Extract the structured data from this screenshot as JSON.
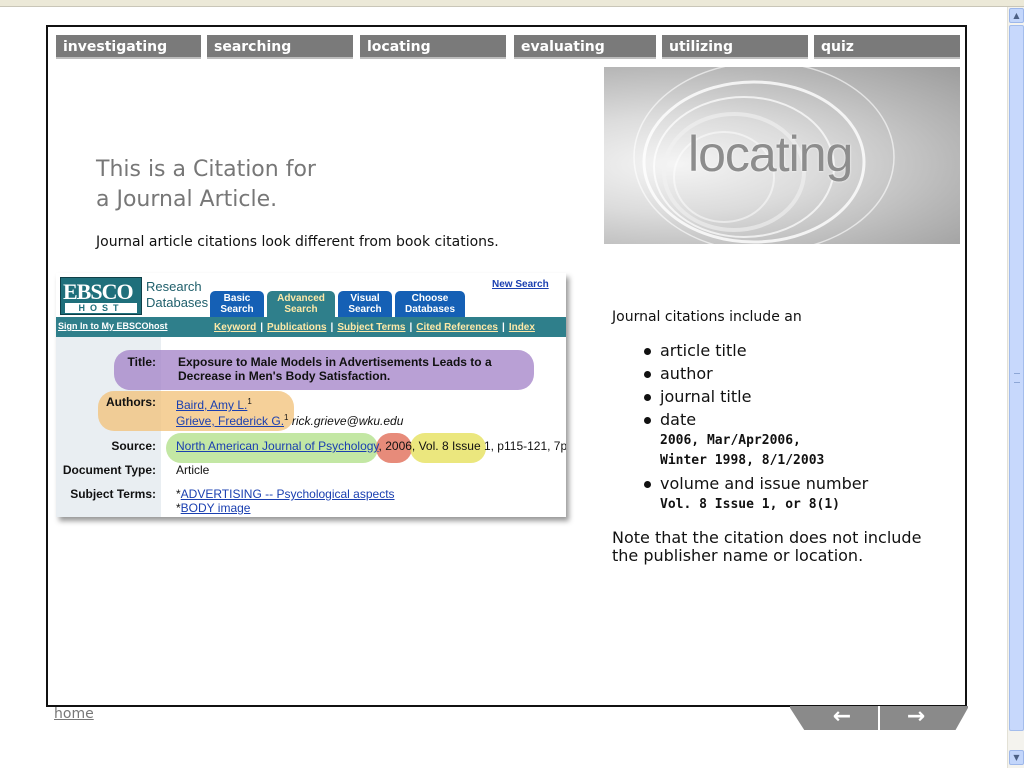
{
  "nav": {
    "tabs": [
      "investigating",
      "searching",
      "locating",
      "evaluating",
      "utilizing",
      "quiz"
    ]
  },
  "hero": {
    "title": "locating"
  },
  "content": {
    "heading_line1": "This is a Citation for",
    "heading_line2": "a Journal Article.",
    "intro": "Journal article citations look different from book citations."
  },
  "ebsco": {
    "logo_top": "EBSCO",
    "logo_bottom": "HOST",
    "research_line1": "Research",
    "research_line2": "Databases",
    "tabs": [
      {
        "line1": "Basic",
        "line2": "Search"
      },
      {
        "line1": "Advanced",
        "line2": "Search"
      },
      {
        "line1": "Visual",
        "line2": "Search"
      },
      {
        "line1": "Choose",
        "line2": "Databases"
      }
    ],
    "new_search": "New Search",
    "sign_in": "Sign In to My EBSCOhost",
    "links": [
      "Keyword",
      "Publications",
      "Subject Terms",
      "Cited References",
      "Index"
    ],
    "record": {
      "title_label": "Title:",
      "title_line1": "Exposure to Male Models in Advertisements Leads to a",
      "title_line2": "Decrease in Men's Body Satisfaction.",
      "authors_label": "Authors:",
      "author1": "Baird, Amy L.",
      "author1_sup": "1",
      "author2": "Grieve, Frederick G.",
      "author2_sup": "1",
      "author2_email": "rick.grieve@wku.edu",
      "source_label": "Source:",
      "journal": "North American Journal of Psychology",
      "year": "2006",
      "volume": "Vol. 8 Issue 1",
      "pages": ", p115-121, 7p",
      "doctype_label": "Document Type:",
      "doctype": "Article",
      "subject_label": "Subject Terms:",
      "subject1": "ADVERTISING -- Psychological aspects",
      "subject2": "BODY image"
    },
    "highlight_colors": {
      "title": "#a585c9",
      "authors": "#f2c37c",
      "journal": "#b2e08a",
      "year": "#e06a55",
      "volume": "#e5e05a"
    }
  },
  "right": {
    "intro": "Journal citations include an",
    "bullets": [
      "article title",
      "author",
      "journal title",
      "date",
      "volume and issue number"
    ],
    "date_example_line1": "2006, Mar/Apr2006,",
    "date_example_line2": "Winter 1998, 8/1/2003",
    "volume_example": "Vol. 8 Issue 1, or 8(1)",
    "note": "Note that the citation does not include the publisher name or location."
  },
  "footer": {
    "home": "home",
    "prev_icon": "arrow-left-icon",
    "next_icon": "arrow-right-icon",
    "prev_glyph": "←",
    "next_glyph": "→"
  }
}
